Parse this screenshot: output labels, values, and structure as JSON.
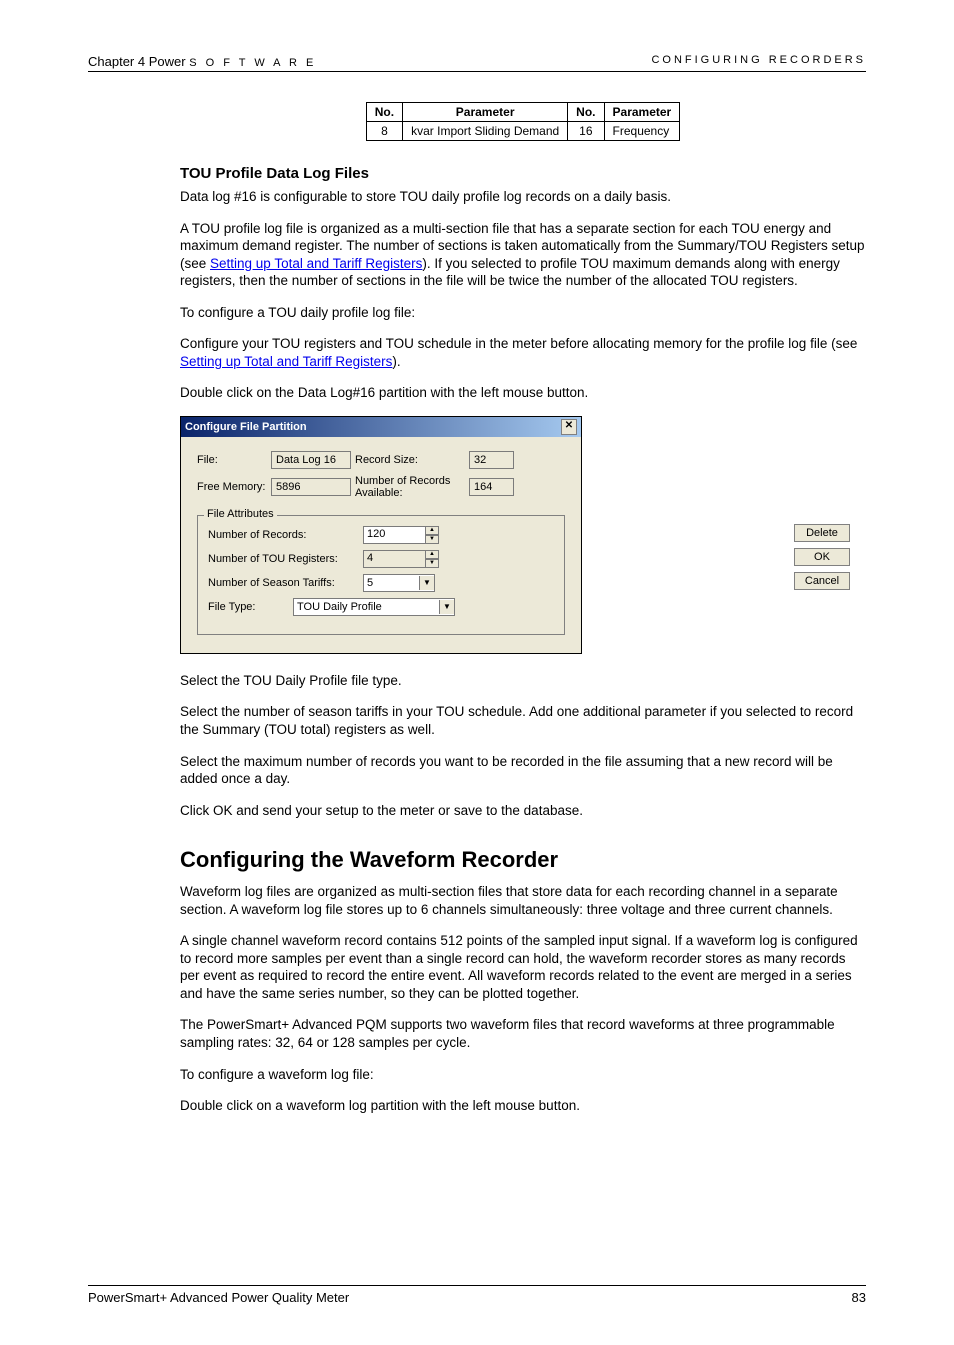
{
  "header": {
    "chapter": "Chapter 4  Power",
    "sw": "S O F T W A R E",
    "right": "CONFIGURING RECORDERS"
  },
  "paramTable": {
    "headers": [
      "No.",
      "Parameter",
      "No.",
      "Parameter"
    ],
    "row": {
      "no1": "8",
      "p1": "kvar Import Sliding Demand",
      "no2": "16",
      "p2": "Frequency"
    }
  },
  "section1": {
    "title": "TOU Profile Data Log Files",
    "p1": "Data log #16 is configurable to store TOU daily profile log records on a daily basis.",
    "p2a": "A TOU profile log file is organized as a multi-section file that has a separate section for each TOU energy and maximum demand register. The number of sections is taken automatically from the Summary/TOU Registers setup (see ",
    "link1": "Setting up Total and Tariff Registers",
    "p2b": "). If you selected to profile TOU maximum demands along with energy registers, then the number of sections in the file will be twice the number of the allocated TOU registers.",
    "p3": "To configure a TOU daily profile log file:",
    "p4a": "Configure your TOU registers and TOU schedule in the meter before allocating memory for the profile log file (see ",
    "link2": "Setting up Total and Tariff Registers",
    "p4b": ").",
    "p5": "Double click on the Data Log#16 partition with the left mouse button."
  },
  "dialog": {
    "title": "Configure File Partition",
    "labels": {
      "file": "File:",
      "freeMemory": "Free Memory:",
      "recordSize": "Record Size:",
      "recordsAvail": "Number of Records Available:",
      "legend": "File Attributes",
      "numRecords": "Number of Records:",
      "numTouReg": "Number of TOU Registers:",
      "numSeason": "Number of Season Tariffs:",
      "fileType": "File Type:"
    },
    "values": {
      "file": "Data Log 16",
      "freeMemory": "5896",
      "recordSize": "32",
      "recordsAvail": "164",
      "numRecords": "120",
      "numTouReg": "4",
      "numSeason": "5",
      "fileType": "TOU Daily Profile"
    },
    "buttons": {
      "delete": "Delete",
      "ok": "OK",
      "cancel": "Cancel"
    }
  },
  "afterDialog": {
    "p1": "Select the TOU Daily Profile file type.",
    "p2": "Select the number of season tariffs in your TOU schedule. Add one additional parameter if you selected to record the Summary (TOU total) registers as well.",
    "p3": "Select the maximum number of records you want to be recorded in the file assuming that a new record will be added once a day.",
    "p4": "Click OK and send your setup to the meter or save to the database."
  },
  "section2": {
    "title": "Configuring the Waveform Recorder",
    "p1": "Waveform log files are organized as multi-section files that store data for each recording channel in a separate section. A waveform log file stores up to 6 channels simultaneously: three voltage and three current channels.",
    "p2": "A single channel waveform record contains 512 points of the sampled input signal. If a waveform log is configured to record more samples per event than a single record can hold, the waveform recorder stores as many records per event as required to record the entire event. All waveform records related to the event are merged in a series and have the same series number, so they can be plotted together.",
    "p3": "The PowerSmart+ Advanced PQM supports two waveform files that record waveforms at three programmable sampling rates: 32, 64 or 128 samples per cycle.",
    "p4": "To configure a waveform log file:",
    "p5": "Double click on a waveform log partition with the left mouse button."
  },
  "footer": {
    "left": "PowerSmart+ Advanced Power Quality Meter",
    "right": "83"
  }
}
